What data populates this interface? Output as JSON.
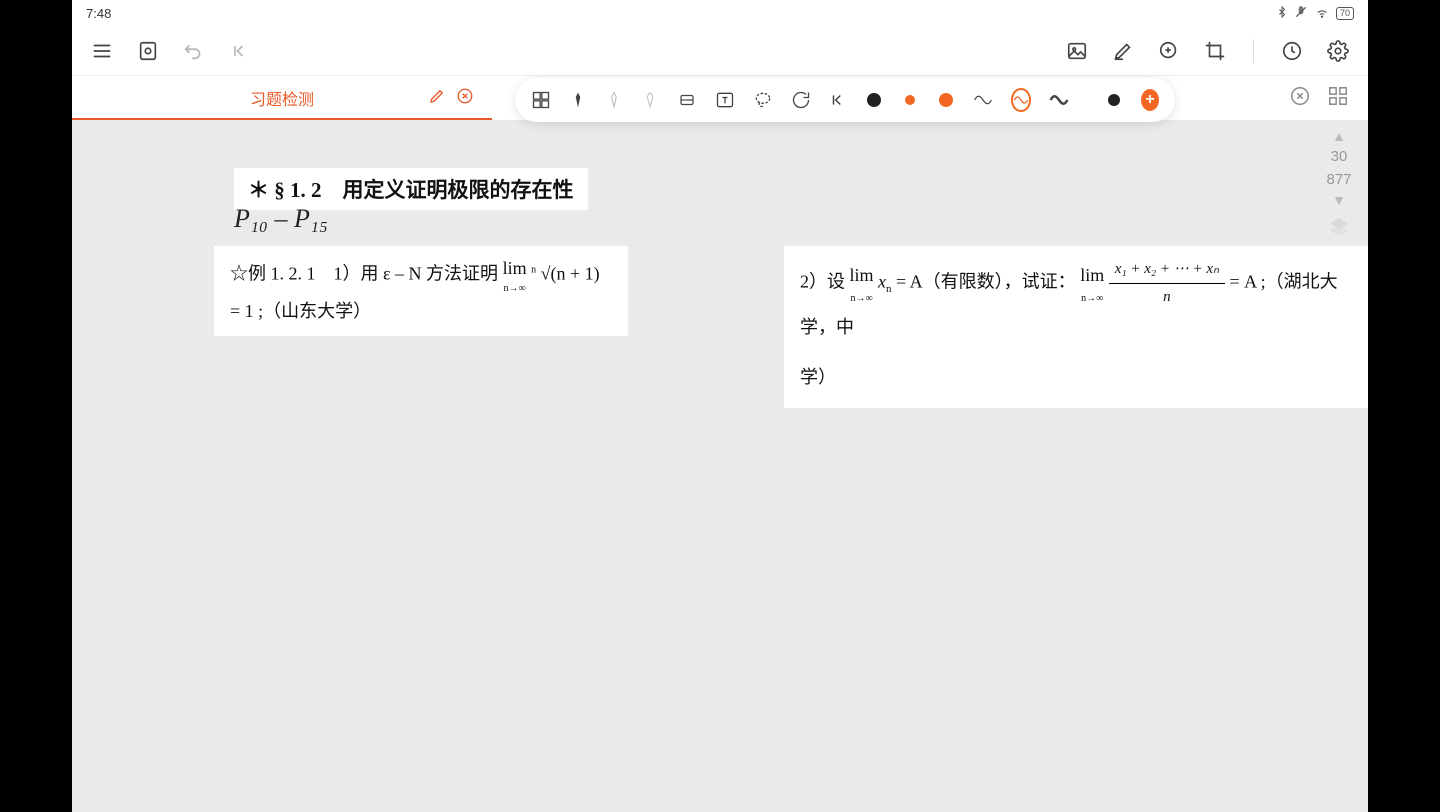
{
  "status_bar": {
    "time": "7:48",
    "battery": "70"
  },
  "tab": {
    "title": "习题检测"
  },
  "page_nav": {
    "current": "30",
    "total": "877"
  },
  "content": {
    "heading": "＊ § 1. 2　用定义证明极限的存在性",
    "handwriting": "P₁₀ – P₁₅",
    "prob1_prefix": "☆例 1. 2. 1　1）用 ε – N 方法证明 ",
    "prob1_limtop": "lim",
    "prob1_limunder": "n→∞",
    "prob1_rootn": "n",
    "prob1_expr": "√(n + 1) = 1 ;（山东大学）",
    "prob2_prefix": "2）设 ",
    "prob2_lim1top": "lim",
    "prob2_lim1under": "n→∞",
    "prob2_lim1sub": "n",
    "prob2_mid": " = A（有限数），试证：",
    "prob2_lim2top": "lim",
    "prob2_lim2under": "n→∞",
    "prob2_num": "x₁ + x₂ + ⋯ + xₙ",
    "prob2_den": "n",
    "prob2_tail": " = A ;（湖北大学，中",
    "prob2_line2": "学）"
  }
}
